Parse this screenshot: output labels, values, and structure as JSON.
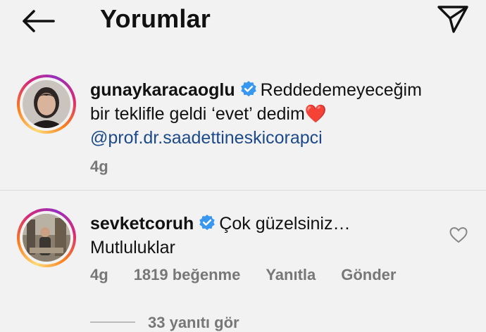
{
  "header": {
    "title": "Yorumlar",
    "back_icon": "arrow-left-icon",
    "send_icon": "paper-plane-icon"
  },
  "comments": [
    {
      "username": "gunaykaracaoglu",
      "verified": true,
      "text_line1": "Reddedemeyeceğim",
      "text_line2": "bir teklifle geldi ‘evet’ dedim",
      "emoji": "❤️",
      "mention": "@prof.dr.saadettineskicorapci",
      "time": "4g"
    },
    {
      "username": "sevketcoruh",
      "verified": true,
      "text_line1": "Çok güzelsiniz…",
      "text_line2": "Mutluluklar",
      "time": "4g",
      "likes": "1819 beğenme",
      "reply": "Yanıtla",
      "send": "Gönder",
      "view_replies": "33 yanıtı gör"
    }
  ],
  "colors": {
    "background": "#f2f2f2",
    "verified_blue": "#3897f0",
    "mention_blue": "#1c4a8a",
    "meta_gray": "#777777"
  }
}
